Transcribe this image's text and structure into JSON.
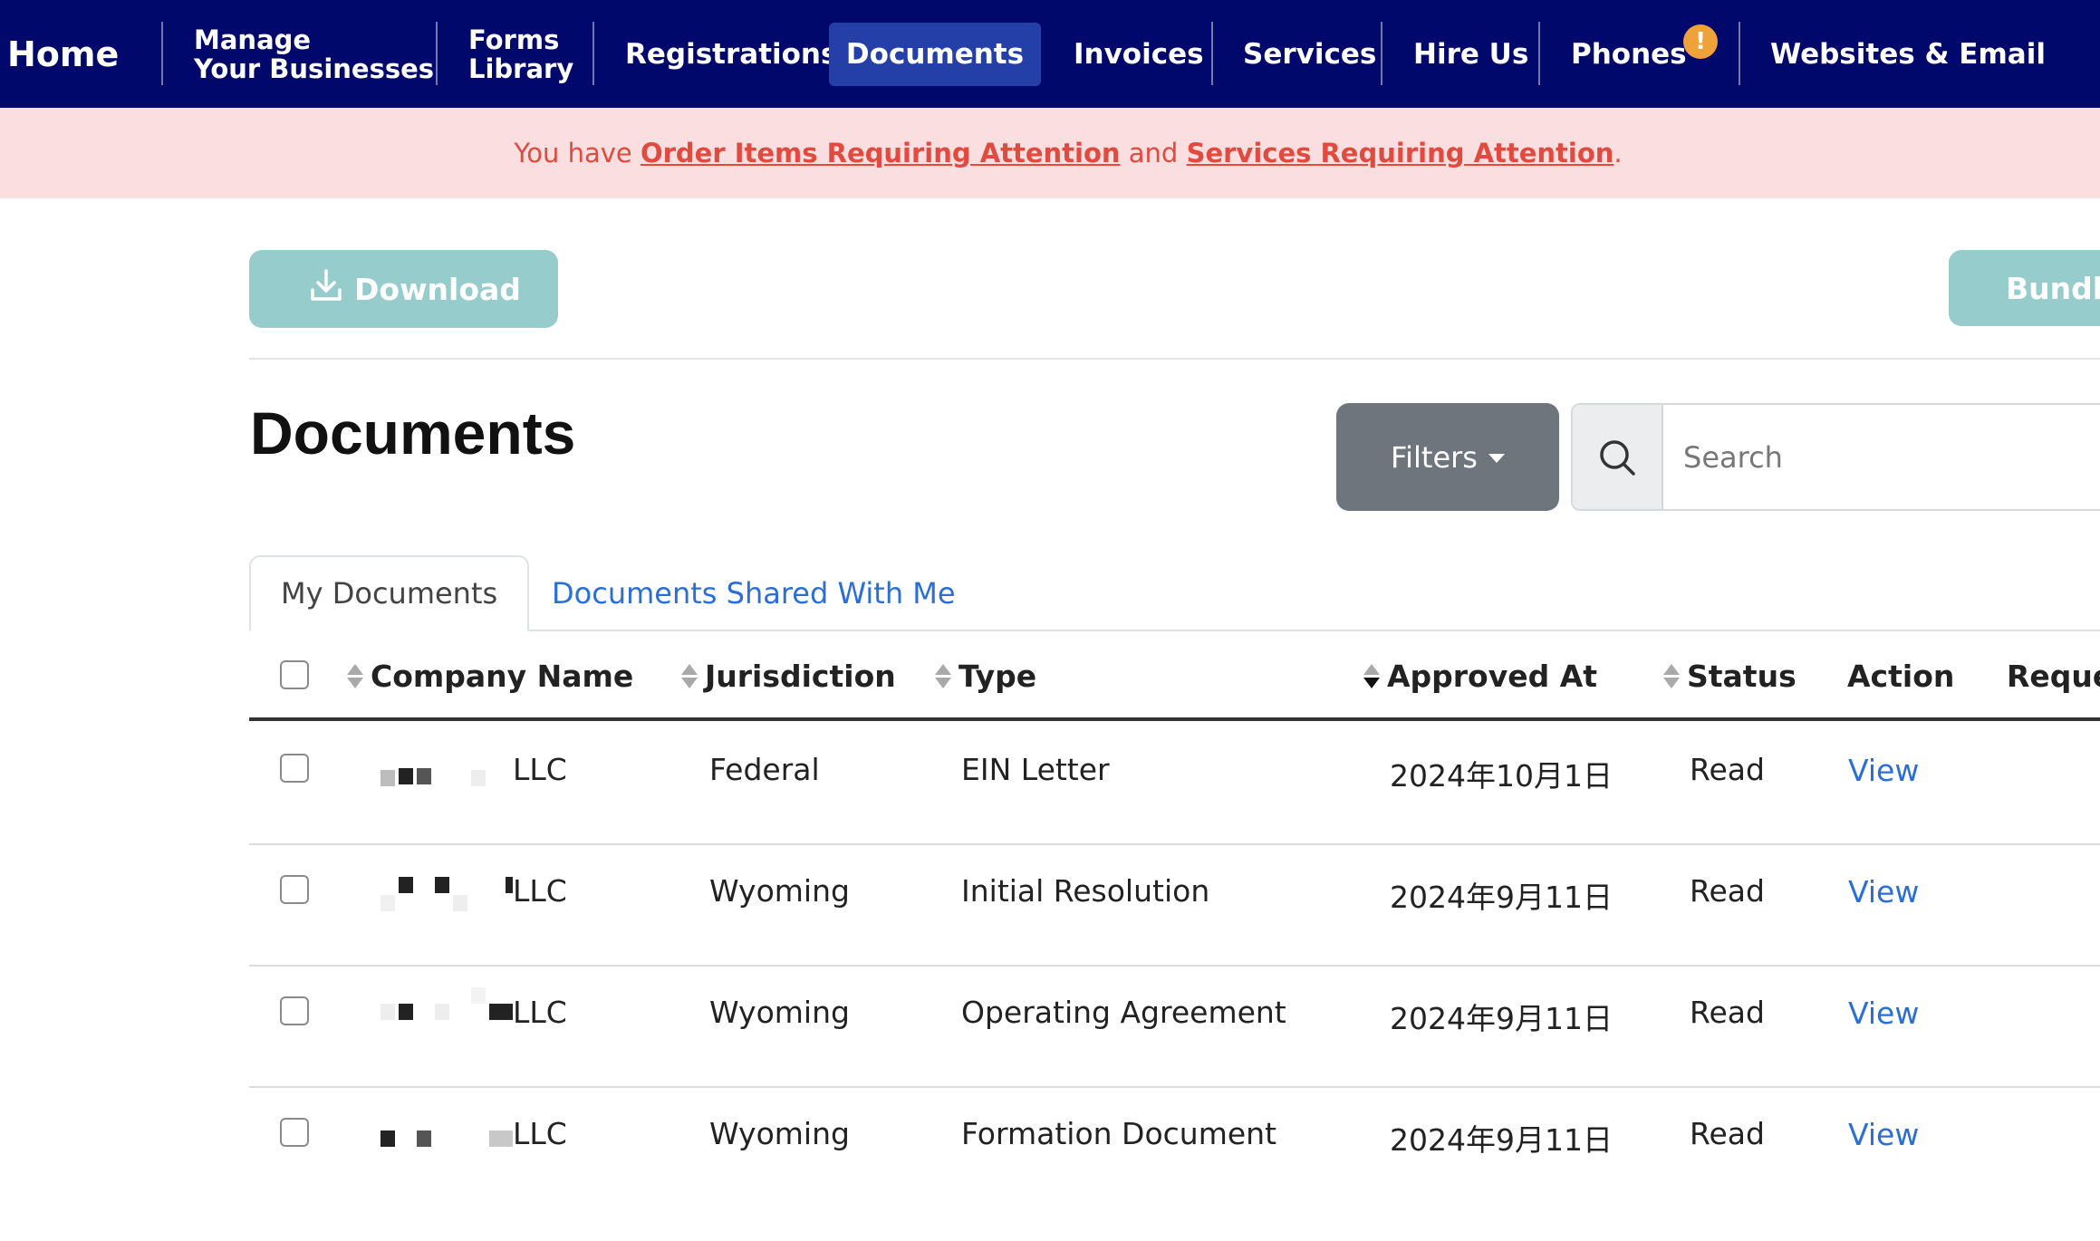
{
  "nav": {
    "home": "Home",
    "manage_line1": "Manage",
    "manage_line2": "Your Businesses",
    "forms_line1": "Forms",
    "forms_line2": "Library",
    "registrations": "Registrations",
    "documents": "Documents",
    "invoices": "Invoices",
    "services": "Services",
    "hire_us": "Hire Us",
    "phones": "Phones",
    "phones_alert": "!",
    "websites_email": "Websites & Email"
  },
  "banner": {
    "prefix": "You have ",
    "link1": "Order Items Requiring Attention",
    "middle": " and ",
    "link2": "Services Requiring Attention",
    "suffix": "."
  },
  "actions": {
    "download": "Download",
    "bundle": "Bundle"
  },
  "page": {
    "title": "Documents"
  },
  "filters": {
    "label": "Filters"
  },
  "search": {
    "placeholder": "Search"
  },
  "tabs": {
    "my_documents": "My Documents",
    "shared": "Documents Shared With Me"
  },
  "table": {
    "headers": {
      "company": "Company Name",
      "jurisdiction": "Jurisdiction",
      "type": "Type",
      "approved": "Approved At",
      "status": "Status",
      "action": "Action",
      "requested": "Reques"
    },
    "rows": [
      {
        "company": "LLC",
        "jurisdiction": "Federal",
        "type": "EIN Letter",
        "approved": "2024年10月1日",
        "status": "Read",
        "action": "View"
      },
      {
        "company": "LLC",
        "jurisdiction": "Wyoming",
        "type": "Initial Resolution",
        "approved": "2024年9月11日",
        "status": "Read",
        "action": "View"
      },
      {
        "company": "LLC",
        "jurisdiction": "Wyoming",
        "type": "Operating Agreement",
        "approved": "2024年9月11日",
        "status": "Read",
        "action": "View"
      },
      {
        "company": "LLC",
        "jurisdiction": "Wyoming",
        "type": "Formation Document",
        "approved": "2024年9月11日",
        "status": "Read",
        "action": "View"
      }
    ]
  },
  "colors": {
    "nav_bg": "#00096b",
    "nav_active": "#2440a8",
    "banner_bg": "#fbdedf",
    "banner_text": "#e04a3f",
    "teal_button": "#96cccb",
    "link_blue": "#2b6fd6",
    "filters_bg": "#6e757d",
    "alert_orange": "#f0a23a"
  }
}
